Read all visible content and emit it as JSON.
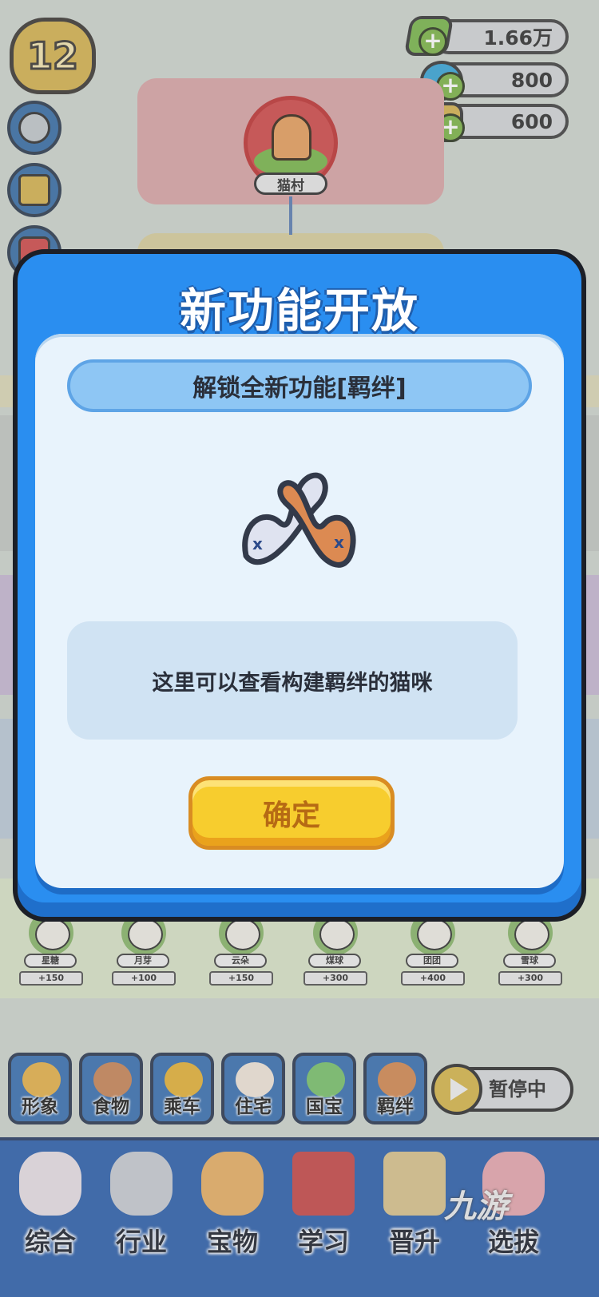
{
  "hud": {
    "level": "12",
    "currencies": [
      {
        "name": "cash",
        "value": "1.66万",
        "color": "#7bb84e"
      },
      {
        "name": "diamond",
        "value": "800",
        "color": "#3aa7d8"
      },
      {
        "name": "fish",
        "value": "600",
        "color": "#d6b451"
      }
    ]
  },
  "map": {
    "node_label": "猫村"
  },
  "cats": [
    {
      "name": "星糖",
      "value": "+150"
    },
    {
      "name": "月芽",
      "value": "+100"
    },
    {
      "name": "云朵",
      "value": "+150"
    },
    {
      "name": "煤球",
      "value": "+300"
    },
    {
      "name": "团团",
      "value": "+400"
    },
    {
      "name": "雪球",
      "value": "+300"
    }
  ],
  "categories": [
    {
      "label": "形象",
      "icon": "cat-head-icon",
      "color": "#e6b24c"
    },
    {
      "label": "食物",
      "icon": "food-bowl-icon",
      "color": "#c8875a"
    },
    {
      "label": "乘车",
      "icon": "bell-icon",
      "color": "#e5b23a"
    },
    {
      "label": "住宅",
      "icon": "calico-cat-icon",
      "color": "#f1e6da"
    },
    {
      "label": "国宝",
      "icon": "green-cat-icon",
      "color": "#7bc36d"
    },
    {
      "label": "羁绊",
      "icon": "bond-tails-icon",
      "color": "#d48a54"
    }
  ],
  "pause": {
    "label": "暂停中"
  },
  "nav": [
    {
      "label": "综合",
      "icon": "paw-icon",
      "color": "#e8e0e6"
    },
    {
      "label": "行业",
      "icon": "cat-icon",
      "color": "#c9ccd4"
    },
    {
      "label": "宝物",
      "icon": "taiyaki-icon",
      "color": "#e8b066"
    },
    {
      "label": "学习",
      "icon": "book-icon",
      "color": "#c74a4a"
    },
    {
      "label": "晋升",
      "icon": "map-icon",
      "color": "#d9c48e"
    },
    {
      "label": "选拔",
      "icon": "cat-bed-icon",
      "color": "#e7a8b0"
    }
  ],
  "modal": {
    "title": "新功能开放",
    "subtitle": "解锁全新功能[羁绊]",
    "description": "这里可以查看构建羁绊的猫咪",
    "confirm_label": "确定"
  },
  "watermark": {
    "text": "九游"
  }
}
